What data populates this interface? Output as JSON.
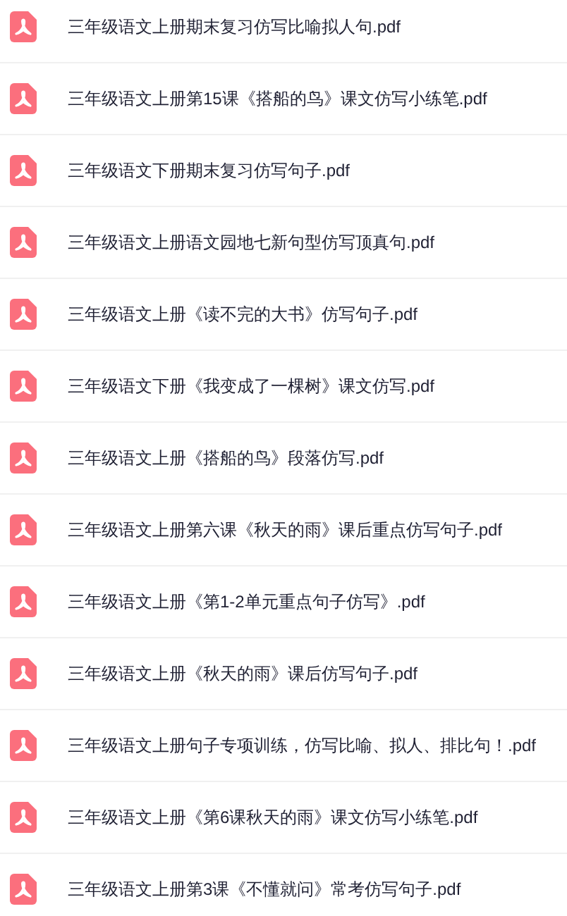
{
  "files": [
    {
      "name": "三年级语文上册期末复习仿写比喻拟人句.pdf"
    },
    {
      "name": "三年级语文上册第15课《搭船的鸟》课文仿写小练笔.pdf"
    },
    {
      "name": "三年级语文下册期末复习仿写句子.pdf"
    },
    {
      "name": "三年级语文上册语文园地七新句型仿写顶真句.pdf"
    },
    {
      "name": "三年级语文上册《读不完的大书》仿写句子.pdf"
    },
    {
      "name": "三年级语文下册《我变成了一棵树》课文仿写.pdf"
    },
    {
      "name": "三年级语文上册《搭船的鸟》段落仿写.pdf"
    },
    {
      "name": "三年级语文上册第六课《秋天的雨》课后重点仿写句子.pdf"
    },
    {
      "name": "三年级语文上册《第1-2单元重点句子仿写》.pdf"
    },
    {
      "name": "三年级语文上册《秋天的雨》课后仿写句子.pdf"
    },
    {
      "name": "三年级语文上册句子专项训练，仿写比喻、拟人、排比句！.pdf"
    },
    {
      "name": "三年级语文上册《第6课秋天的雨》课文仿写小练笔.pdf"
    },
    {
      "name": "三年级语文上册第3课《不懂就问》常考仿写句子.pdf"
    }
  ]
}
